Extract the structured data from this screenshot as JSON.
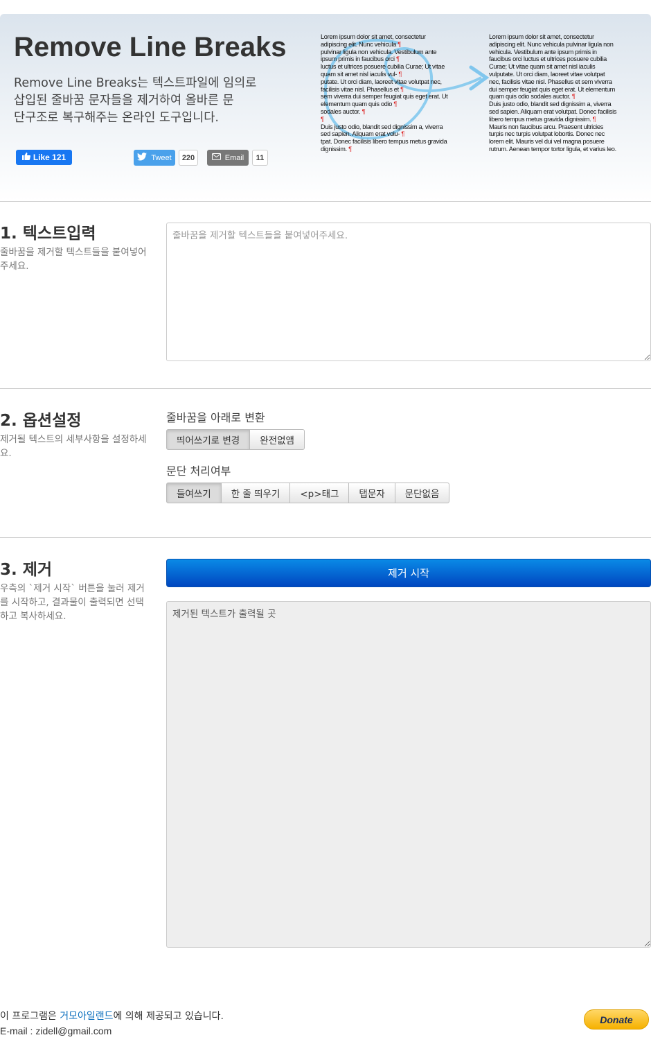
{
  "header": {
    "title": "Remove Line Breaks",
    "lead_line1": "Remove Line Breaks는 텍스트파일에 임의로",
    "lead_line2": "삽입된 줄바꿈 문자들을 제거하여 올바른 문",
    "lead_line3": "단구조로 복구해주는 온라인 도구입니다.",
    "fb_like_label": "Like 121",
    "tweet_label": "Tweet",
    "tweet_count": "220",
    "email_label": "Email",
    "email_count": "11"
  },
  "sample_before": [
    "Lorem ipsum dolor sit amet, consectetur",
    "adipiscing elit. Nunc vehicula",
    "pulvinar ligula non vehicula. Vestibulum ante",
    "ipsum primis in faucibus orci",
    "luctus et ultrices posuere cubilia Curae; Ut vitae",
    "quam sit amet nisl iaculis vul-",
    "putate. Ut orci diam, laoreet vitae volutpat nec,",
    "facilisis vitae nisl. Phasellus et",
    "sem viverra dui semper feugiat quis eget erat. Ut",
    "elementum quam quis odio",
    "sodales auctor.",
    "",
    "Duis justo odio, blandit sed dignissim a, viverra",
    "sed sapien. Aliquam erat volu-",
    "tpat. Donec facilisis libero tempus metus gravida",
    "dignissim."
  ],
  "sample_after": [
    "   Lorem ipsum dolor sit amet, consectetur",
    "adipiscing elit. Nunc vehicula pulvinar ligula non",
    "vehicula. Vestibulum ante ipsum primis in",
    "faucibus orci luctus et ultrices posuere cubilia",
    "Curae; Ut vitae quam sit amet nisl iaculis",
    "vulputate. Ut orci diam, laoreet vitae volutpat",
    "nec, facilisis vitae nisl. Phasellus et sem viverra",
    "dui semper feugiat quis eget erat. Ut elementum",
    "quam quis odio sodales auctor.",
    "   Duis justo odio, blandit sed dignissim a, viverra",
    "sed sapien. Aliquam erat volutpat. Donec facilisis",
    "libero tempus metus gravida dignissim.",
    "   Mauris non faucibus arcu. Praesent ultricies",
    "turpis nec turpis volutpat lobortis. Donec nec",
    "lorem elit. Mauris vel dui vel magna posuere",
    "rutrum. Aenean tempor tortor ligula, et varius leo."
  ],
  "pilcrow": "¶",
  "section1": {
    "title": "1. 텍스트입력",
    "desc": "줄바꿈을 제거할 텍스트들을 붙여넣어주세요.",
    "placeholder": "줄바꿈을 제거할 텍스트들을 붙여넣어주세요."
  },
  "section2": {
    "title": "2. 옵션설정",
    "desc": "제거될 텍스트의 세부사항을 설정하세요.",
    "linebreak_label": "줄바꿈을 아래로 변환",
    "linebreak_options": [
      "띄어쓰기로 변경",
      "완전없앰"
    ],
    "paragraph_label": "문단 처리여부",
    "paragraph_options": [
      "들여쓰기",
      "한 줄 띄우기",
      "<p>태그",
      "탭문자",
      "문단없음"
    ]
  },
  "section3": {
    "title": "3. 제거",
    "desc": "우측의 `제거 시작` 버튼을 눌러 제거를 시작하고, 결과물이 출력되면 선택하고 복사하세요.",
    "start_button": "제거 시작",
    "output_text": "제거된 텍스트가 출력될 곳"
  },
  "footer": {
    "line1_prefix": "이 프로그램은 ",
    "line1_link": "거모아일랜드",
    "line1_suffix": "에 의해 제공되고 있습니다.",
    "email_line": "E-mail : zidell@gmail.com",
    "donate_label": "Donate"
  },
  "colors": {
    "accent": "#0a6ebd",
    "start_button": "#0058d0",
    "pilcrow": "#dd2222"
  }
}
